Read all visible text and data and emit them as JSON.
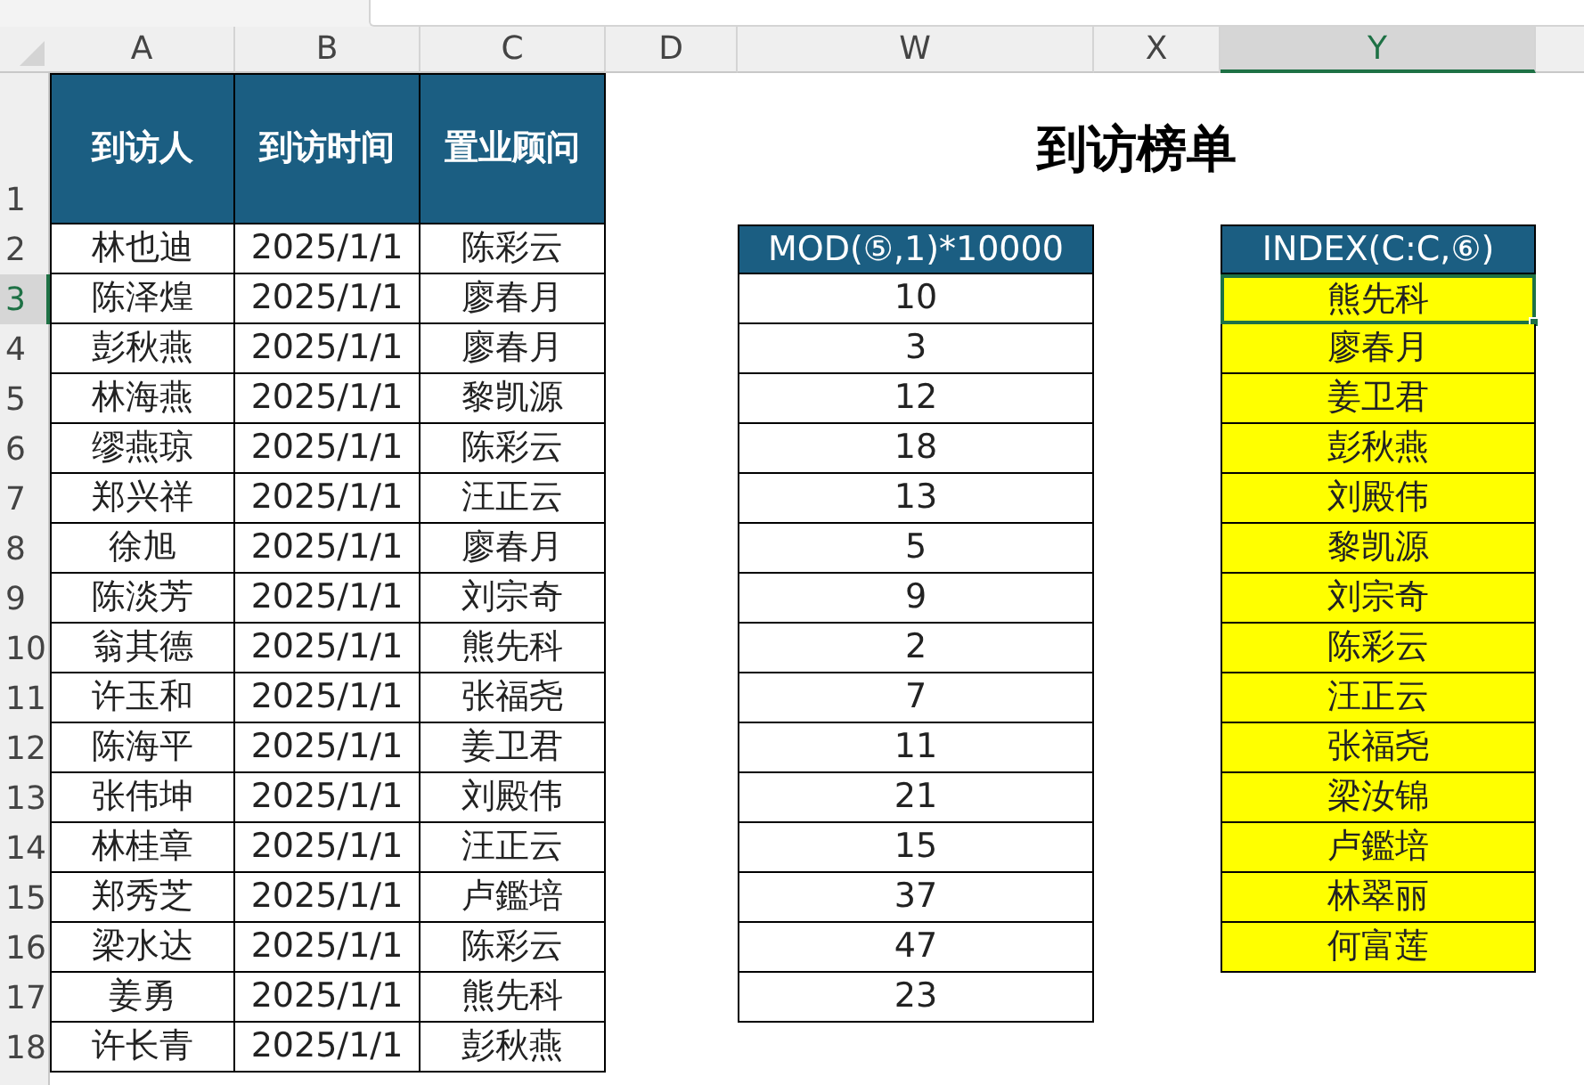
{
  "column_headers": [
    {
      "label": "A",
      "selected": false
    },
    {
      "label": "B",
      "selected": false
    },
    {
      "label": "C",
      "selected": false
    },
    {
      "label": "D",
      "selected": false
    },
    {
      "label": "W",
      "selected": false
    },
    {
      "label": "X",
      "selected": false
    },
    {
      "label": "Y",
      "selected": true
    }
  ],
  "row_numbers": [
    {
      "label": "1",
      "selected": false
    },
    {
      "label": "2",
      "selected": false
    },
    {
      "label": "3",
      "selected": true
    },
    {
      "label": "4",
      "selected": false
    },
    {
      "label": "5",
      "selected": false
    },
    {
      "label": "6",
      "selected": false
    },
    {
      "label": "7",
      "selected": false
    },
    {
      "label": "8",
      "selected": false
    },
    {
      "label": "9",
      "selected": false
    },
    {
      "label": "10",
      "selected": false
    },
    {
      "label": "11",
      "selected": false
    },
    {
      "label": "12",
      "selected": false
    },
    {
      "label": "13",
      "selected": false
    },
    {
      "label": "14",
      "selected": false
    },
    {
      "label": "15",
      "selected": false
    },
    {
      "label": "16",
      "selected": false
    },
    {
      "label": "17",
      "selected": false
    },
    {
      "label": "18",
      "selected": false
    }
  ],
  "visitor_table": {
    "columns": [
      "到访人",
      "到访时间",
      "置业顾问"
    ],
    "rows": [
      [
        "林也迪",
        "2025/1/1",
        "陈彩云"
      ],
      [
        "陈泽煌",
        "2025/1/1",
        "廖春月"
      ],
      [
        "彭秋燕",
        "2025/1/1",
        "廖春月"
      ],
      [
        "林海燕",
        "2025/1/1",
        "黎凯源"
      ],
      [
        "缪燕琼",
        "2025/1/1",
        "陈彩云"
      ],
      [
        "郑兴祥",
        "2025/1/1",
        "汪正云"
      ],
      [
        "徐旭",
        "2025/1/1",
        "廖春月"
      ],
      [
        "陈淡芳",
        "2025/1/1",
        "刘宗奇"
      ],
      [
        "翁其德",
        "2025/1/1",
        "熊先科"
      ],
      [
        "许玉和",
        "2025/1/1",
        "张福尧"
      ],
      [
        "陈海平",
        "2025/1/1",
        "姜卫君"
      ],
      [
        "张伟坤",
        "2025/1/1",
        "刘殿伟"
      ],
      [
        "林桂章",
        "2025/1/1",
        "汪正云"
      ],
      [
        "郑秀芝",
        "2025/1/1",
        "卢鑑培"
      ],
      [
        "梁水达",
        "2025/1/1",
        "陈彩云"
      ],
      [
        "姜勇",
        "2025/1/1",
        "熊先科"
      ],
      [
        "许长青",
        "2025/1/1",
        "彭秋燕"
      ]
    ]
  },
  "title": "到访榜单",
  "mod_table": {
    "header": "MOD(⑤,1)*10000",
    "values": [
      "10",
      "3",
      "12",
      "18",
      "13",
      "5",
      "9",
      "2",
      "7",
      "11",
      "21",
      "15",
      "37",
      "47",
      "23"
    ]
  },
  "index_table": {
    "header": "INDEX(C:C,⑥)",
    "cells": [
      {
        "text": "熊先科",
        "selected": true
      },
      {
        "text": "廖春月",
        "selected": false
      },
      {
        "text": "姜卫君",
        "selected": false
      },
      {
        "text": "彭秋燕",
        "selected": false
      },
      {
        "text": "刘殿伟",
        "selected": false
      },
      {
        "text": "黎凯源",
        "selected": false
      },
      {
        "text": "刘宗奇",
        "selected": false
      },
      {
        "text": "陈彩云",
        "selected": false
      },
      {
        "text": "汪正云",
        "selected": false
      },
      {
        "text": "张福尧",
        "selected": false
      },
      {
        "text": "梁汝锦",
        "selected": false
      },
      {
        "text": "卢鑑培",
        "selected": false
      },
      {
        "text": "林翠丽",
        "selected": false
      },
      {
        "text": "何富莲",
        "selected": false
      }
    ]
  }
}
